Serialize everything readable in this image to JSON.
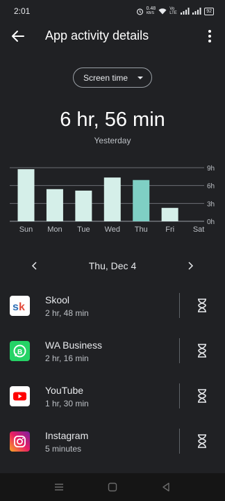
{
  "status_bar": {
    "time": "2:01",
    "net_speed_value": "0.48",
    "net_speed_unit": "KB/S",
    "network_label": "Vo LTE",
    "battery": "92"
  },
  "app_bar": {
    "title": "App activity details"
  },
  "metric_selector": {
    "selected": "Screen time"
  },
  "summary": {
    "total": "6 hr, 56 min",
    "period": "Yesterday"
  },
  "chart_data": {
    "type": "bar",
    "categories": [
      "Sun",
      "Mon",
      "Tue",
      "Wed",
      "Thu",
      "Fri",
      "Sat"
    ],
    "values": [
      8.75,
      5.4,
      5.15,
      7.35,
      6.93,
      2.25,
      0
    ],
    "highlighted_category": "Thu",
    "y_ticks": [
      "0h",
      "3h",
      "6h",
      "9h"
    ],
    "ylim": [
      0,
      9
    ],
    "grid": true,
    "bar_color": "#d5efe9",
    "highlight_color": "#7fcfc4"
  },
  "date_nav": {
    "label": "Thu, Dec 4"
  },
  "apps": [
    {
      "name": "Skool",
      "time": "2 hr, 48 min",
      "icon": "skool-icon"
    },
    {
      "name": "WA Business",
      "time": "2 hr, 16 min",
      "icon": "wa-business-icon"
    },
    {
      "name": "YouTube",
      "time": "1 hr, 30 min",
      "icon": "youtube-icon"
    },
    {
      "name": "Instagram",
      "time": "5 minutes",
      "icon": "instagram-icon"
    }
  ]
}
